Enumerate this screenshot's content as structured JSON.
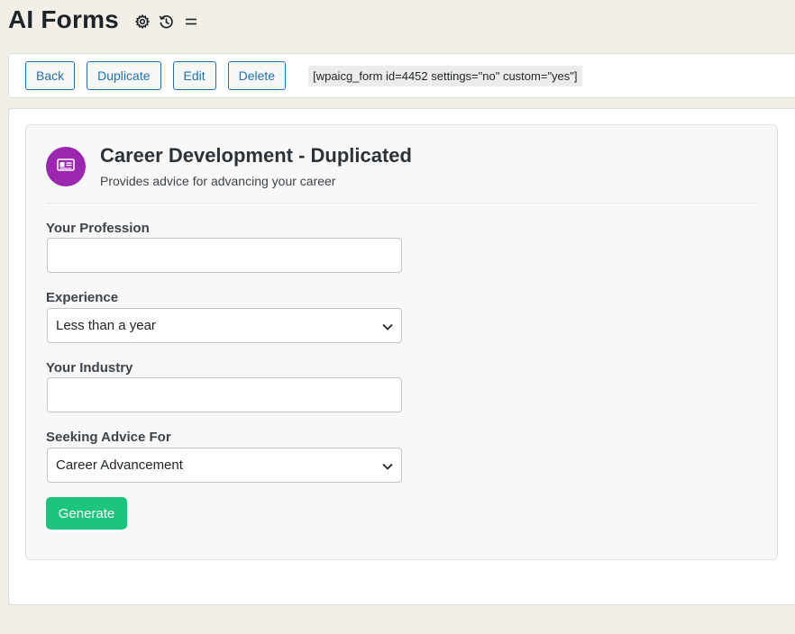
{
  "page": {
    "title": "AI Forms"
  },
  "header_icons": [
    "gear-icon",
    "history-icon",
    "menu-icon"
  ],
  "toolbar": {
    "back_label": "Back",
    "duplicate_label": "Duplicate",
    "edit_label": "Edit",
    "delete_label": "Delete",
    "shortcode": "[wpaicg_form id=4452 settings=\"no\" custom=\"yes\"]"
  },
  "form": {
    "icon": "id-card-icon",
    "title": "Career Development - Duplicated",
    "description": "Provides advice for advancing your career",
    "fields": [
      {
        "label": "Your Profession",
        "type": "text",
        "value": ""
      },
      {
        "label": "Experience",
        "type": "select",
        "value": "Less than a year"
      },
      {
        "label": "Your Industry",
        "type": "text",
        "value": ""
      },
      {
        "label": "Seeking Advice For",
        "type": "select",
        "value": "Career Advancement"
      }
    ],
    "submit_label": "Generate"
  },
  "colors": {
    "page_bg": "#f1efe8",
    "accent": "#2271b1",
    "avatar": "#9b27af",
    "generate": "#1cc47e"
  }
}
